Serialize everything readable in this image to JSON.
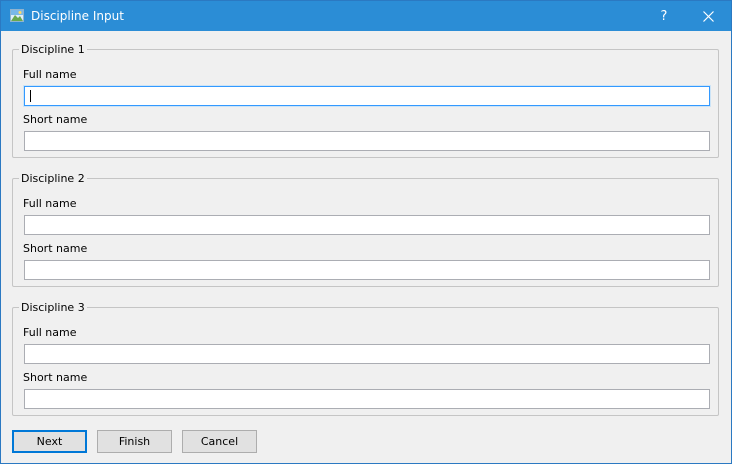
{
  "window": {
    "title": "Discipline Input",
    "help_label": "?"
  },
  "disciplines": [
    {
      "title": "Discipline 1",
      "full_name_label": "Full name",
      "full_name_value": "",
      "short_name_label": "Short name",
      "short_name_value": ""
    },
    {
      "title": "Discipline 2",
      "full_name_label": "Full name",
      "full_name_value": "",
      "short_name_label": "Short name",
      "short_name_value": ""
    },
    {
      "title": "Discipline 3",
      "full_name_label": "Full name",
      "full_name_value": "",
      "short_name_label": "Short name",
      "short_name_value": ""
    }
  ],
  "buttons": {
    "next": "Next",
    "finish": "Finish",
    "cancel": "Cancel"
  },
  "colors": {
    "titlebar": "#2b8dd6",
    "focus_border": "#3399ff",
    "default_button_border": "#0078d7"
  },
  "icons": {
    "app": "app-icon",
    "help": "help-icon",
    "close": "close-icon"
  }
}
